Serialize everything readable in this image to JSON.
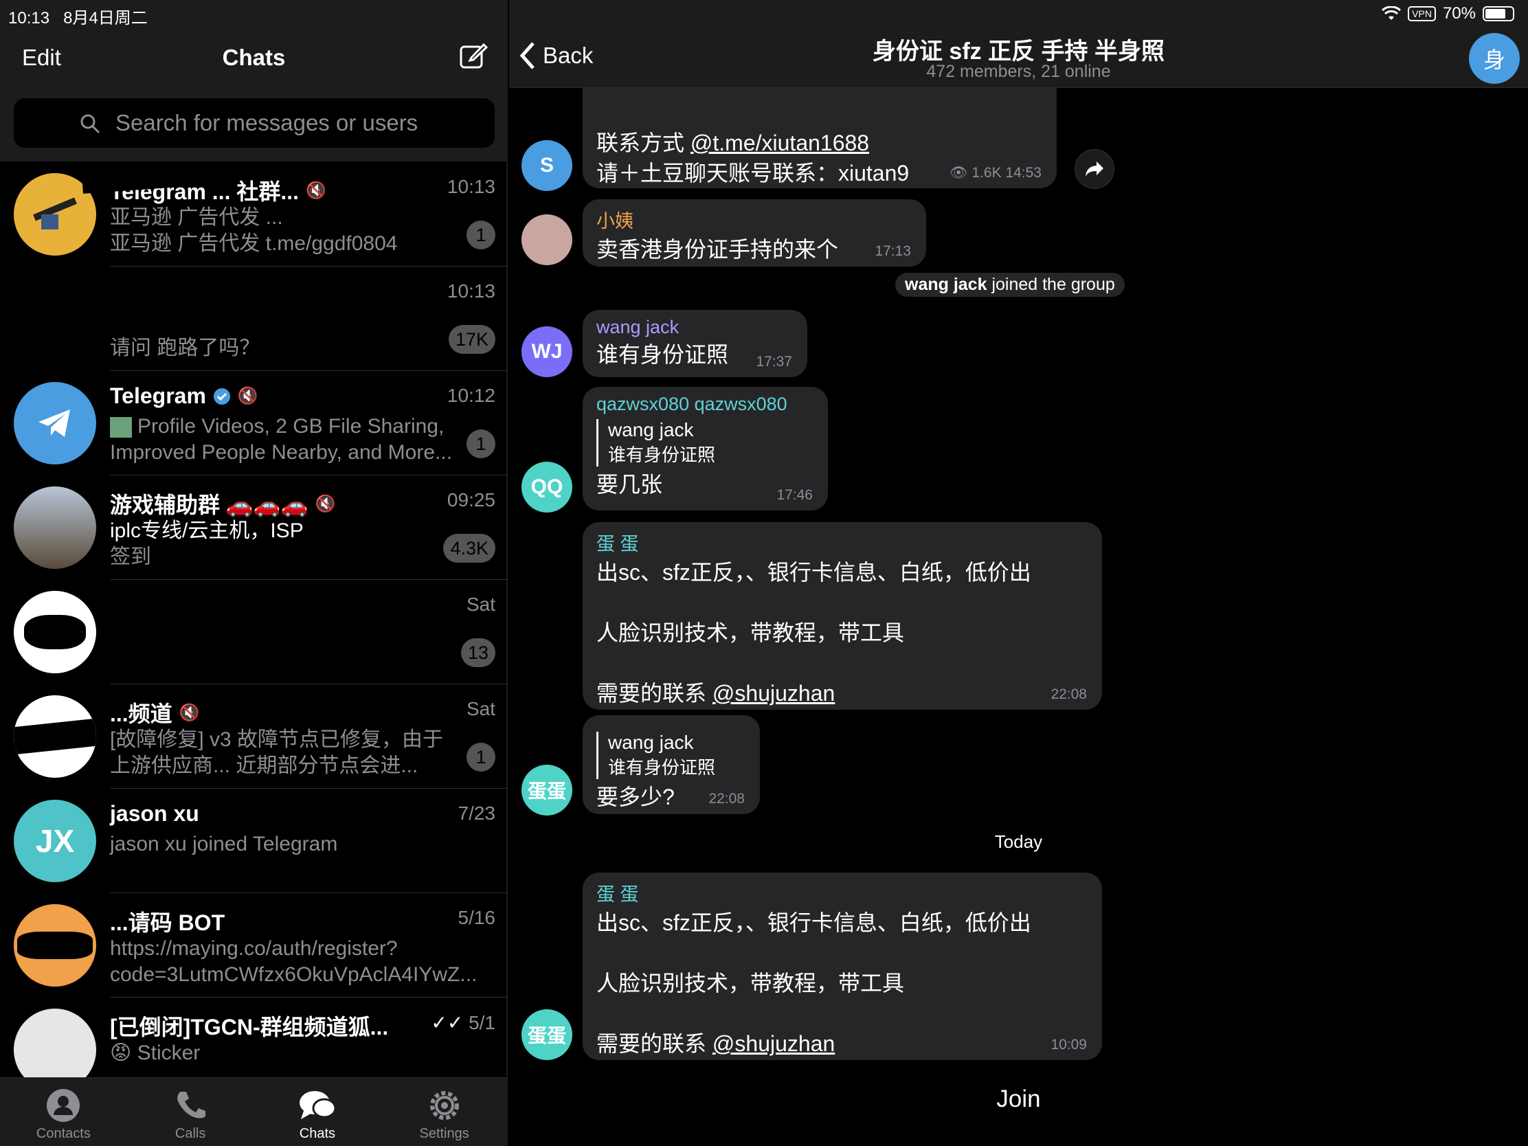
{
  "status": {
    "time": "10:13",
    "date": "8月4日周二",
    "vpn": "VPN",
    "battery": "70%"
  },
  "list_header": {
    "edit": "Edit",
    "title": "Chats"
  },
  "search": {
    "placeholder": "Search for messages or users"
  },
  "chats": [
    {
      "name": "Telegram ... 社群...",
      "time": "10:13",
      "preview1": "亚马逊 广告代发 ...",
      "preview2": "亚马逊 广告代发 t.me/ggdf0804",
      "badge": "1",
      "muted": true,
      "avatar_color": "#e8b23a"
    },
    {
      "name": "",
      "time": "10:13",
      "preview1": "",
      "preview2": "请问 跑路了吗？",
      "badge": "17K",
      "avatar_color": "#000"
    },
    {
      "name": "Telegram",
      "time": "10:12",
      "preview1": "Profile Videos, 2 GB File Sharing,",
      "preview2": "Improved People Nearby, and More...",
      "badge": "1",
      "verified": true,
      "muted": true,
      "avatar_color": "#4a9de0"
    },
    {
      "name": "游戏辅助群 🚗🚗🚗",
      "time": "09:25",
      "preview1": "iplc专线/云主机，ISP",
      "preview2": "签到",
      "badge": "4.3K",
      "muted": true,
      "avatar_color": "#6b6257"
    },
    {
      "name": "",
      "time": "Sat",
      "preview1": "",
      "preview2": "",
      "badge": "13",
      "avatar_color": "#fff"
    },
    {
      "name": "...频道",
      "time": "Sat",
      "preview1": "[故障修复] v3 故障节点已修复，由于",
      "preview2": "上游供应商... 近期部分节点会进...",
      "badge": "1",
      "muted": true,
      "avatar_color": "#fff"
    },
    {
      "name": "jason xu",
      "time": "7/23",
      "preview1": "jason xu joined Telegram",
      "preview2": "",
      "badge": "",
      "avatar_text": "JX",
      "avatar_color": "#4fc3c7"
    },
    {
      "name": "...请码 BOT",
      "time": "5/16",
      "preview1": "https://maying.co/auth/register?",
      "preview2": "code=3LutmCWfzx6OkuVpAclA4IYwZ...",
      "badge": "",
      "avatar_color": "#f0a14a"
    },
    {
      "name": "[已倒闭]TGCN-群组频道狐...",
      "time": "5/1",
      "preview1": "😡 Sticker",
      "preview2": "",
      "badge": "",
      "avatar_color": "#e6e6e6"
    }
  ],
  "tabs": {
    "contacts": "Contacts",
    "calls": "Calls",
    "chats": "Chats",
    "settings": "Settings"
  },
  "group": {
    "title": "身份证 sfz 正反 手持 半身照",
    "subtitle": "472 members, 21 online",
    "back": "Back",
    "avatar": "身"
  },
  "messages": {
    "m1": {
      "line1_a": "联系方式 ",
      "line1_link": "@t.me/xiutan1688",
      "line2": "请＋土豆聊天账号联系：xiutan9",
      "views": "1.6K",
      "time": "14:53",
      "avatar": "S"
    },
    "m2": {
      "sender": "小姨",
      "text": "卖香港身份证手持的来个",
      "time": "17:13"
    },
    "sys1": {
      "bold": "wang jack",
      "rest": " joined the group"
    },
    "m3": {
      "sender": "wang jack",
      "text": "谁有身份证照",
      "time": "17:37",
      "avatar": "WJ"
    },
    "m4": {
      "sender": "qazwsx080 qazwsx080",
      "quote_name": "wang jack",
      "quote_text": "谁有身份证照",
      "text": "要几张",
      "time": "17:46",
      "avatar": "QQ"
    },
    "m5": {
      "sender": "蛋 蛋",
      "line1": "出sc、sfz正反，、银行卡信息、白纸，低价出",
      "line2": "人脸识别技术，带教程，带工具",
      "line3_a": "需要的联系 ",
      "line3_link": "@shujuzhan",
      "time": "22:08"
    },
    "m6": {
      "quote_name": "wang jack",
      "quote_text": "谁有身份证照",
      "text": "要多少?",
      "time": "22:08",
      "avatar": "蛋蛋"
    },
    "today": "Today",
    "m7": {
      "sender": "蛋 蛋",
      "line1": "出sc、sfz正反，、银行卡信息、白纸，低价出",
      "line2": "人脸识别技术，带教程，带工具",
      "line3_a": "需要的联系 ",
      "line3_link": "@shujuzhan",
      "time": "10:09",
      "avatar": "蛋蛋"
    }
  },
  "join": "Join"
}
